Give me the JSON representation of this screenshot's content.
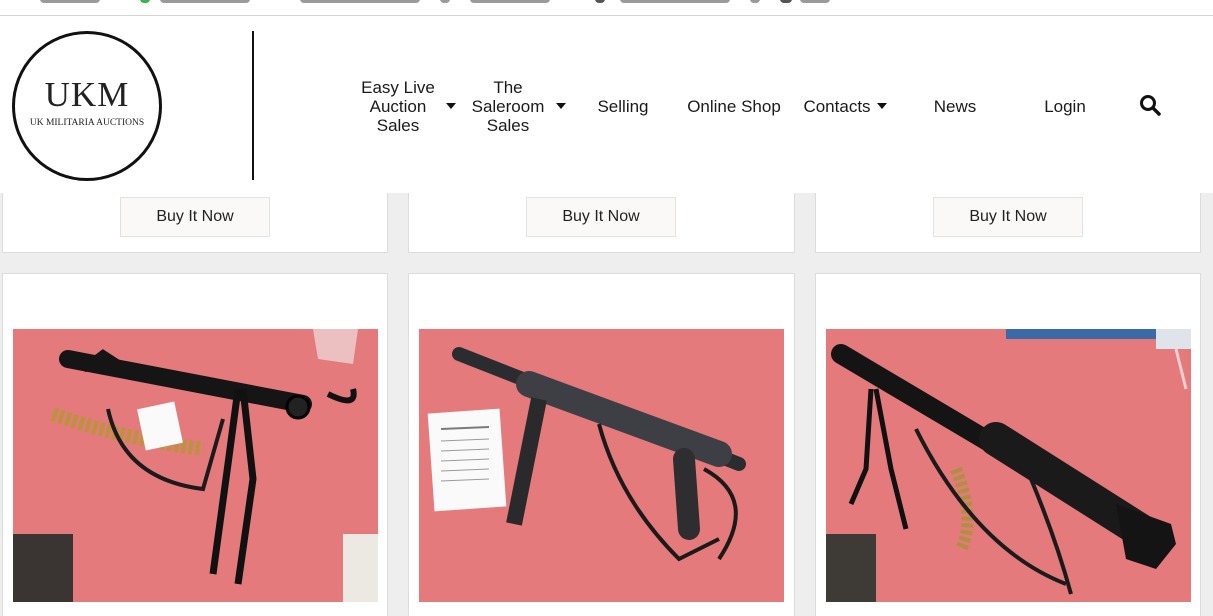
{
  "logo": {
    "title": "UKM",
    "subtitle": "UK MILITARIA AUCTIONS"
  },
  "nav": {
    "easy_live_label": "Easy Live Auction Sales",
    "saleroom_label": "The Saleroom Sales",
    "selling_label": "Selling",
    "online_shop_label": "Online Shop",
    "contacts_label": "Contacts",
    "news_label": "News",
    "login_label": "Login"
  },
  "products_top_row": [
    {
      "button_label": "Buy It Now"
    },
    {
      "button_label": "Buy It Now"
    },
    {
      "button_label": "Buy It Now"
    }
  ],
  "products_bottom_row": [
    {
      "image": "mg34-machine-gun-photo"
    },
    {
      "image": "mp40-submachine-gun-photo"
    },
    {
      "image": "mg42-machine-gun-photo"
    }
  ],
  "colors": {
    "header_bg": "#ffffff",
    "page_bg": "#eeeeee",
    "photo_cloth": "#e47a7c",
    "button_bg": "#faf9f7"
  }
}
